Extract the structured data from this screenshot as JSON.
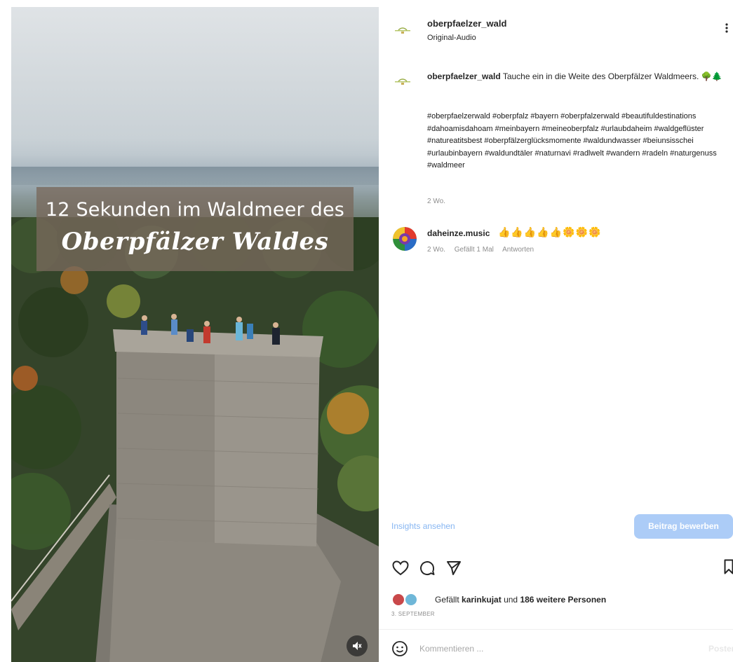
{
  "post_media": {
    "overlay_line1": "12 Sekunden im Waldmeer des",
    "overlay_line2": "Oberpfälzer Waldes",
    "mute_icon": "speaker-muted-icon"
  },
  "header": {
    "username": "oberpfaelzer_wald",
    "audio_label": "Original-Audio",
    "more_icon": "more-options-icon"
  },
  "caption": {
    "username": "oberpfaelzer_wald",
    "text": "Tauche ein in die Weite des Oberpfälzer Waldmeers. 🌳🌲",
    "hashtags": "#oberpfaelzerwald #oberpfalz #bayern #oberpfalzerwald #beautifuldestinations #dahoamisdahoam #meinbayern #meineoberpfalz #urlaubdaheim #waldgeflüster #natureatitsbest #oberpfälzerglücksmomente #waldundwasser #beiunsisschei #urlaubinbayern #waldundtäler #naturnavi #radlwelt #wandern #radeln #naturgenuss #waldmeer",
    "age": "2 Wo."
  },
  "comment": {
    "username": "daheinze.music",
    "emojis": "👍👍👍👍👍🌼🌼🌼",
    "age": "2 Wo.",
    "likes": "Gefällt 1 Mal",
    "reply": "Antworten"
  },
  "footer": {
    "insights_label": "Insights ansehen",
    "edit_button": "Beitrag bewerben",
    "likes_prefix": "Gefällt",
    "likes_user": "karinkujat",
    "likes_middle": "und",
    "likes_count": "186 weitere Personen",
    "date": "3. SEPTEMBER",
    "comment_placeholder": "Kommentieren ...",
    "post_label": "Posten"
  },
  "colors": {
    "accent_light": "#acccf7",
    "link": "#87b6f2",
    "muted_text": "#8e8e8e"
  }
}
